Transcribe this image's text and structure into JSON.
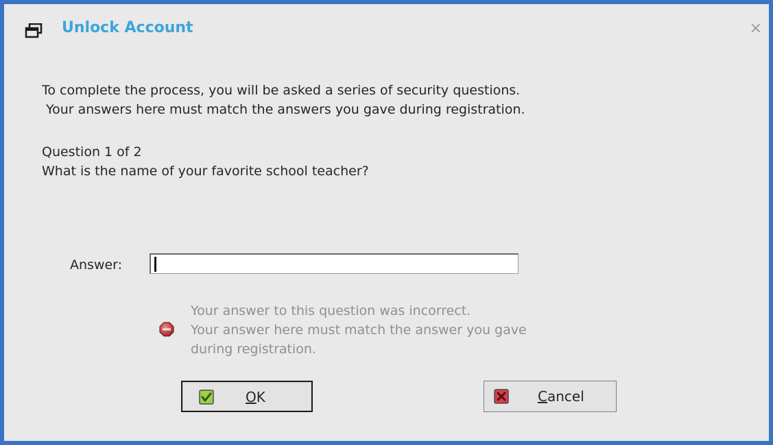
{
  "dialog": {
    "title": "Unlock Account",
    "close_glyph": "×",
    "window_icon": "window-icon"
  },
  "intro": {
    "line1": "To complete the process, you will be asked a series of security questions.",
    "line2": "Your answers here must match the answers you gave during registration."
  },
  "question": {
    "number": "Question 1 of 2",
    "text": "What is the name of your favorite school teacher?"
  },
  "answer": {
    "label": "Answer:",
    "value": ""
  },
  "error": {
    "icon": "stop-icon",
    "line1": "Your answer to this question was incorrect.",
    "line2": "Your answer here must match the answer you gave",
    "line3": "during registration."
  },
  "buttons": {
    "ok": {
      "mnemonic": "O",
      "rest": "K",
      "icon": "check-icon"
    },
    "cancel": {
      "mnemonic": "C",
      "rest": "ancel",
      "icon": "x-icon"
    }
  },
  "colors": {
    "title": "#3aa6dc",
    "frame": "#3a73c4",
    "error_text": "#8f8f8f"
  }
}
